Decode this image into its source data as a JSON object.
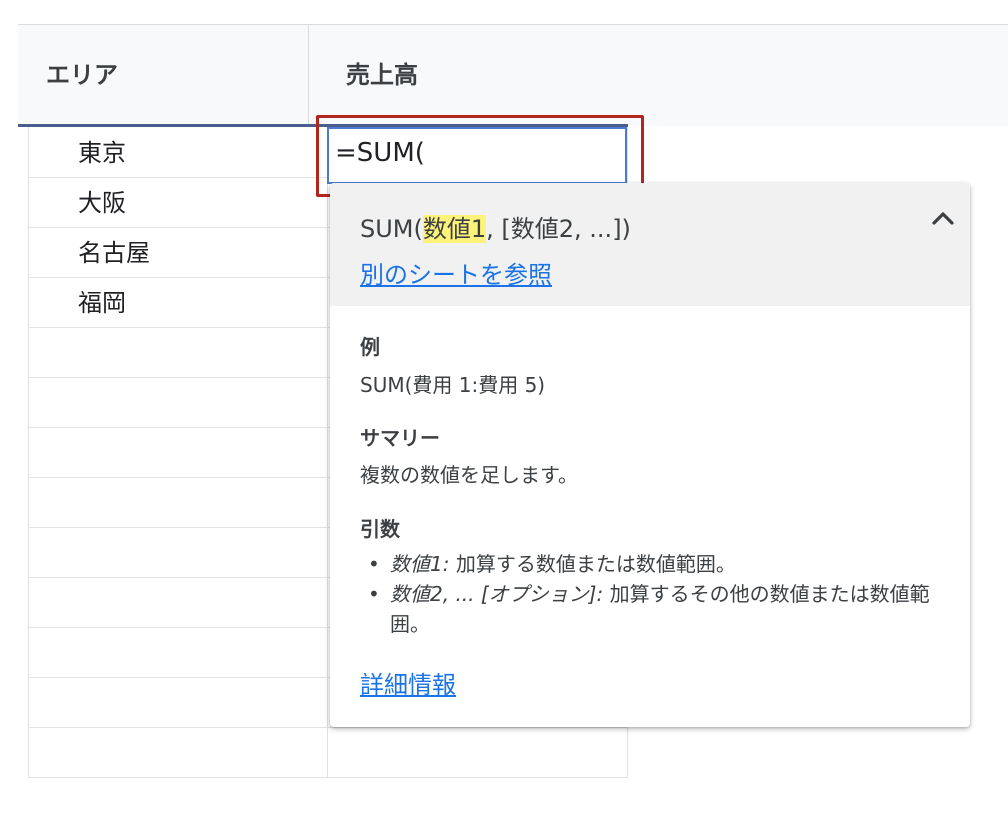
{
  "columns": {
    "area": "エリア",
    "sales": "売上高"
  },
  "rows": [
    {
      "area": "東京"
    },
    {
      "area": "大阪"
    },
    {
      "area": "名古屋"
    },
    {
      "area": "福岡"
    }
  ],
  "active_cell": {
    "value": "=SUM("
  },
  "function_help": {
    "signature_prefix": "SUM(",
    "signature_highlight": "数値1",
    "signature_suffix": ", [数値2, ...])",
    "reference_link": "別のシートを参照",
    "collapse_icon": "chevron-up-icon",
    "example_title": "例",
    "example_text": "SUM(費用 1:費用 5)",
    "summary_title": "サマリー",
    "summary_text": "複数の数値を足します。",
    "arguments_title": "引数",
    "arguments": [
      {
        "name": "数値1:",
        "description": " 加算する数値または数値範囲。"
      },
      {
        "name": "数値2, ... [オプション]:",
        "description": " 加算するその他の数値または数値範囲。"
      }
    ],
    "more_link": "詳細情報"
  },
  "colors": {
    "highlight_border": "#b3261e",
    "active_cell_border": "#4a7bd0",
    "link": "#1a73e8",
    "param_highlight": "#fdf37a"
  }
}
